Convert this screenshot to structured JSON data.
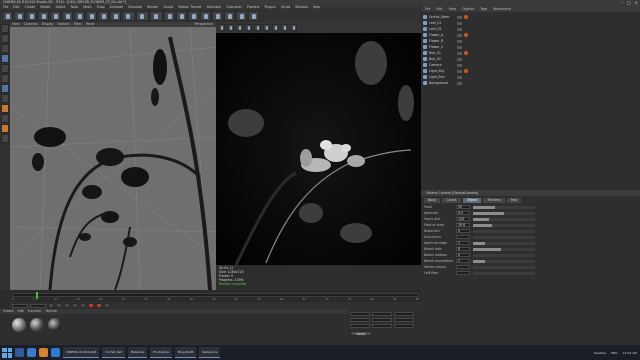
{
  "window": {
    "title": "CINEMA 4D R19.024 Studio (RC - R19) - [C4D_ORCHID_FLOWER_2P_04.c4d *]"
  },
  "menu": [
    "File",
    "Edit",
    "Create",
    "Modes",
    "Select",
    "Tools",
    "Mesh",
    "Snap",
    "Animate",
    "Simulate",
    "Render",
    "Sculpt",
    "Motion Tracker",
    "MoGraph",
    "Character",
    "Pipeline",
    "Plugins",
    "Script",
    "Window",
    "Help"
  ],
  "viewport": {
    "menu": [
      "View",
      "Cameras",
      "Display",
      "Options",
      "Filter",
      "Panel"
    ],
    "label": "Perspective"
  },
  "render_view": {
    "title": "Interactive Render",
    "status_lines": [
      "00:00:12",
      "Size: 1280x720",
      "Frame: 0",
      "Progress: 100%"
    ],
    "status_accent": "Render complete"
  },
  "object_manager": {
    "tabs": [
      "File",
      "Edit",
      "View",
      "Objects",
      "Tags",
      "Bookmarks"
    ],
    "objects": [
      "Orchid_Stem",
      "Leaf_01",
      "Leaf_02",
      "Flower_A",
      "Flower_B",
      "Flower_C",
      "Bud_01",
      "Bud_02",
      "Camera",
      "Light_Key",
      "Light_Rim",
      "Background"
    ]
  },
  "attributes": {
    "title": "Octane Camera [OctaneCamera]",
    "tabs": [
      "Basic",
      "Coord.",
      "Object",
      "Thinlens",
      "Post"
    ],
    "active_tab": "Object",
    "rows": [
      {
        "label": "Focal",
        "value": "50",
        "fill": 0.35
      },
      {
        "label": "Aperture",
        "value": "0.5",
        "fill": 0.5
      },
      {
        "label": "Focus dist.",
        "value": "120",
        "fill": 0.25
      },
      {
        "label": "Field of view",
        "value": "39.6",
        "fill": 0.3
      },
      {
        "label": "Distortion",
        "value": "0",
        "fill": 0.0
      },
      {
        "label": "Auto focus",
        "value": "",
        "fill": 0.0
      },
      {
        "label": "Aperture edge",
        "value": "1",
        "fill": 0.2
      },
      {
        "label": "Bokeh side",
        "value": "6",
        "fill": 0.45
      },
      {
        "label": "Bokeh rotation",
        "value": "0",
        "fill": 0.0
      },
      {
        "label": "Bokeh roundedness",
        "value": "1",
        "fill": 0.2
      },
      {
        "label": "Stereo output",
        "value": "",
        "fill": 0.0
      },
      {
        "label": "Left filter",
        "value": "",
        "fill": 0.0
      }
    ]
  },
  "timeline": {
    "ticks": [
      "0",
      "5",
      "10",
      "15",
      "20",
      "25",
      "30",
      "35",
      "40",
      "45",
      "50",
      "55",
      "60",
      "65",
      "70",
      "75",
      "80",
      "85",
      "90"
    ],
    "position": 0.06
  },
  "materials": {
    "tabs": [
      "Create",
      "Edit",
      "Function",
      "Texture"
    ]
  },
  "coordinates": {
    "apply_label": "Apply"
  },
  "taskbar": {
    "items": [
      "CINEMA 4D R19.024",
      "Orchid_Ref",
      "Materials",
      "Photoshop",
      "Blog Draft",
      "Reference"
    ],
    "tray": [
      "Desktop",
      "ENG",
      "10:24 AM"
    ]
  },
  "colors": {
    "accent_orange": "#c57a2c",
    "accent_green": "#4bb34e",
    "record_red": "#b93a32"
  }
}
